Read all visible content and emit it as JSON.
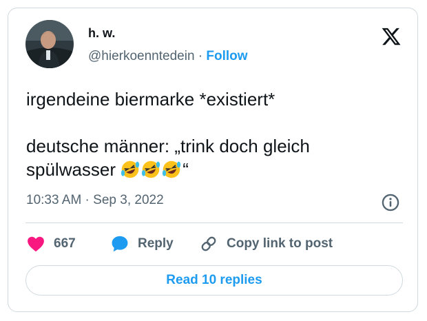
{
  "author": {
    "display_name": "h. w.",
    "handle": "@hierkoenntedein",
    "separator": "·",
    "follow_label": "Follow"
  },
  "tweet": {
    "line1": "irgendeine biermarke *existiert*",
    "line2": "deutsche männer: „trink doch gleich",
    "line3_prefix": "spülwasser ",
    "line3_suffix": "“",
    "emoji": [
      "🤣",
      "🤣",
      "🤣"
    ],
    "timestamp": "10:33 AM · Sep 3, 2022"
  },
  "actions": {
    "like_count": "667",
    "reply_label": "Reply",
    "copy_label": "Copy link to post"
  },
  "read_replies_label": "Read 10 replies",
  "colors": {
    "accent": "#1d9bf0",
    "like": "#f91880",
    "text": "#0f1419",
    "muted": "#536471",
    "border": "#cfd9de"
  },
  "icons": [
    "x-logo-icon",
    "heart-icon",
    "speech-bubble-icon",
    "link-icon",
    "info-icon",
    "rolling-laughing-emoji"
  ]
}
